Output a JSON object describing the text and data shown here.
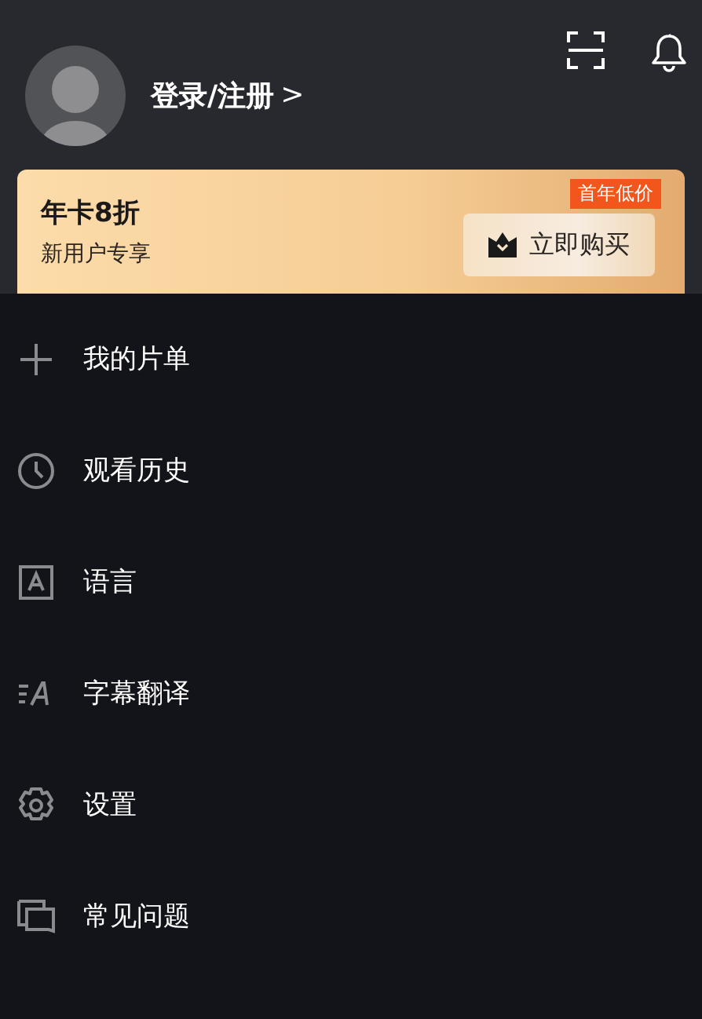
{
  "profile": {
    "login_label": "登录/注册",
    "chevron": ">"
  },
  "promo": {
    "title": "年卡8折",
    "subtitle": "新用户专享",
    "button": "立即购买",
    "badge": "首年低价"
  },
  "menu": [
    {
      "kind": "add",
      "label": "我的片单"
    },
    {
      "kind": "history",
      "label": "观看历史"
    },
    {
      "kind": "language",
      "label": "语言"
    },
    {
      "kind": "subtitle",
      "label": "字幕翻译"
    },
    {
      "kind": "settings",
      "label": "设置"
    },
    {
      "kind": "faq",
      "label": "常见问题"
    }
  ]
}
